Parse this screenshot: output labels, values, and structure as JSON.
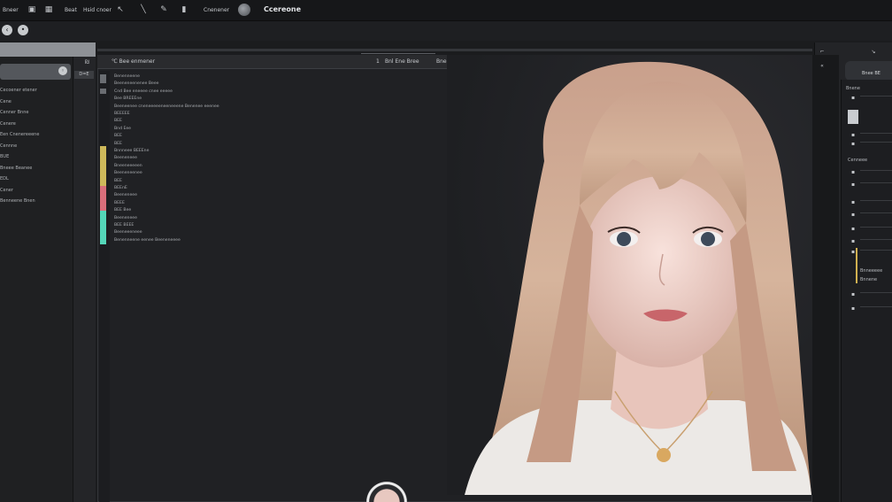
{
  "menubar": {
    "items": [
      "Bneer",
      "Beat",
      "Hsid cnoer"
    ],
    "zoom_label": "Cnenener",
    "title": "Ccereone"
  },
  "left_panel": {
    "col2_top": "₪",
    "col2_label": "D=E",
    "items": [
      "Cecoener etener",
      "Cene",
      "Cenner Bnne",
      "Cenere",
      "Een Cnenereeene",
      "Cennne",
      "BUE",
      "Bneee Beanee",
      "EDL",
      "Cener",
      "Benneene Bnen"
    ]
  },
  "editor": {
    "tabs": [
      "℃ Bee enmener",
      "1",
      "Bnl Ene Bree",
      "Bnenenee"
    ],
    "lines": [
      "Benenneene",
      "Beeneneenenee Beee",
      "Cnd Bee eneeee cnee eeeee",
      "Bee BREEEne",
      "Beeneenee cneneeeeeneeneeene Benenee eeenee",
      "BEEEEE",
      "BEE",
      "Bnd Eee",
      "BEE",
      "BEE",
      "Bnnneee BEEEne",
      "Beeneneee",
      "Bneeneeeeen",
      "Beeneneenee",
      "BEE",
      "BEEnE",
      "Beeneneee",
      "BEEE",
      "BEE Bee",
      "Beeneneee",
      "BEE BEEE",
      "Beeneeeneee",
      "Benenneene eenee Beeneneeee"
    ]
  },
  "right_panel": {
    "head_label": "Bnee BE",
    "section_label": "Cenneee",
    "labels": [
      "Bnene",
      "Bnneeeee",
      "Bnnene"
    ]
  },
  "colors": {
    "accent_yellow": "#cdb85a",
    "accent_pink": "#d86e7a",
    "accent_teal": "#54d6b8"
  }
}
